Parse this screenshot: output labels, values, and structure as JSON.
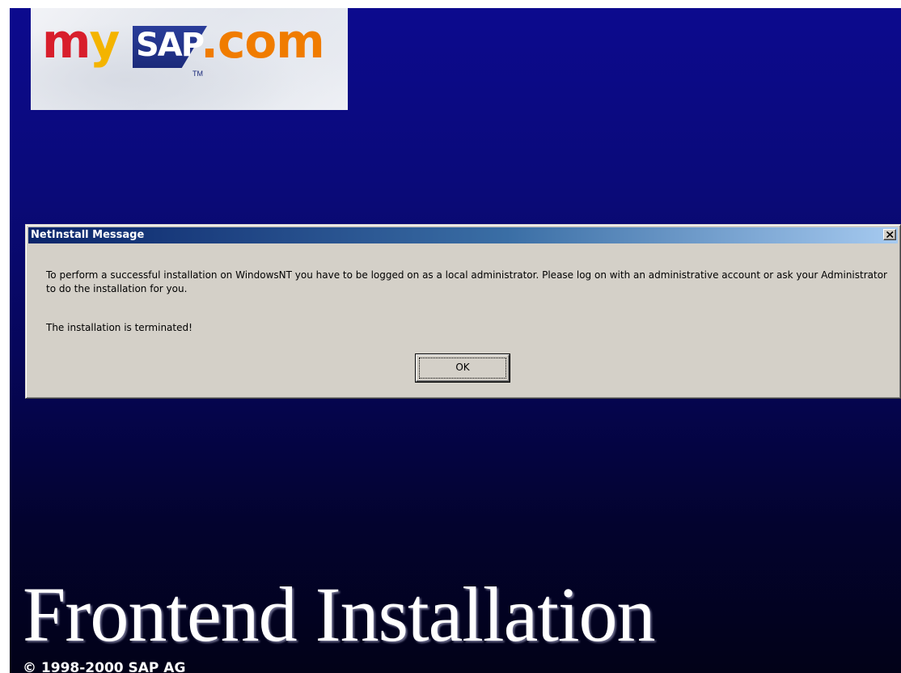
{
  "logo": {
    "part_my": "my",
    "part_sap": "SAP",
    "part_com": ".com",
    "trademark": "TM",
    "colors": {
      "m": "#d81e2c",
      "y": "#f4b400",
      "sap_box": "#1b2a7a",
      "com": "#f07c00"
    }
  },
  "dialog": {
    "title": "NetInstall Message",
    "close_icon": "close-icon",
    "message_1": "To perform a successful installation on WindowsNT you have to be logged on as a local administrator. Please log on with an administrative account or ask your Administrator to do the installation for you.",
    "message_2": "The installation is terminated!",
    "ok_label": "OK"
  },
  "installer": {
    "title": "Frontend Installation",
    "copyright": "© 1998-2000 SAP AG",
    "background_colors": [
      "#0c0a8e",
      "#020218"
    ]
  }
}
